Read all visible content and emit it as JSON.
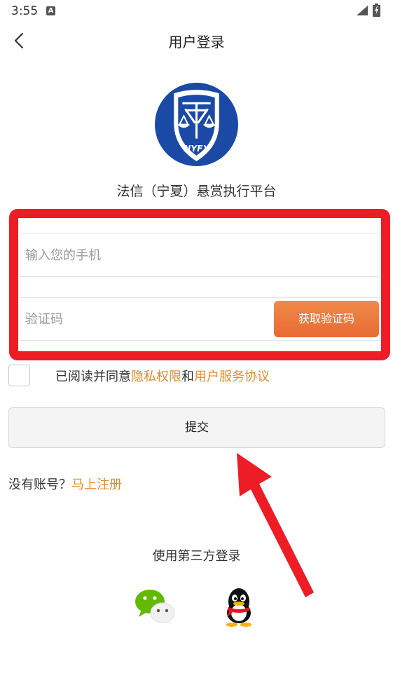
{
  "status_bar": {
    "time": "3:55",
    "notification_letter": "A",
    "icons": [
      "signal-icon",
      "battery-icon"
    ]
  },
  "nav": {
    "title": "用户登录",
    "back_icon": "back-chevron-icon"
  },
  "logo": {
    "text": "NYFX",
    "icon": "scales-of-justice-shield-logo",
    "colors": {
      "primary": "#1a4aa6",
      "white": "#ffffff"
    }
  },
  "platform_name": "法信（宁夏）悬赏执行平台",
  "form": {
    "phone_placeholder": "输入您的手机",
    "phone_value": "",
    "code_placeholder": "验证码",
    "code_value": "",
    "get_code_label": "获取验证码"
  },
  "agreement": {
    "checked": false,
    "prefix": "已阅读并同意",
    "privacy_link": "隐私权限",
    "and": "和",
    "terms_link": "用户服务协议"
  },
  "submit_label": "提交",
  "register": {
    "prompt": "没有账号？",
    "link": "马上注册"
  },
  "third_party": {
    "label": "使用第三方登录",
    "providers": [
      "wechat-icon",
      "qq-icon"
    ]
  },
  "colors": {
    "accent_orange": "#e98a2a",
    "button_gradient_start": "#f08a48",
    "button_gradient_end": "#e86a34",
    "highlight_red": "#ee1c25"
  }
}
